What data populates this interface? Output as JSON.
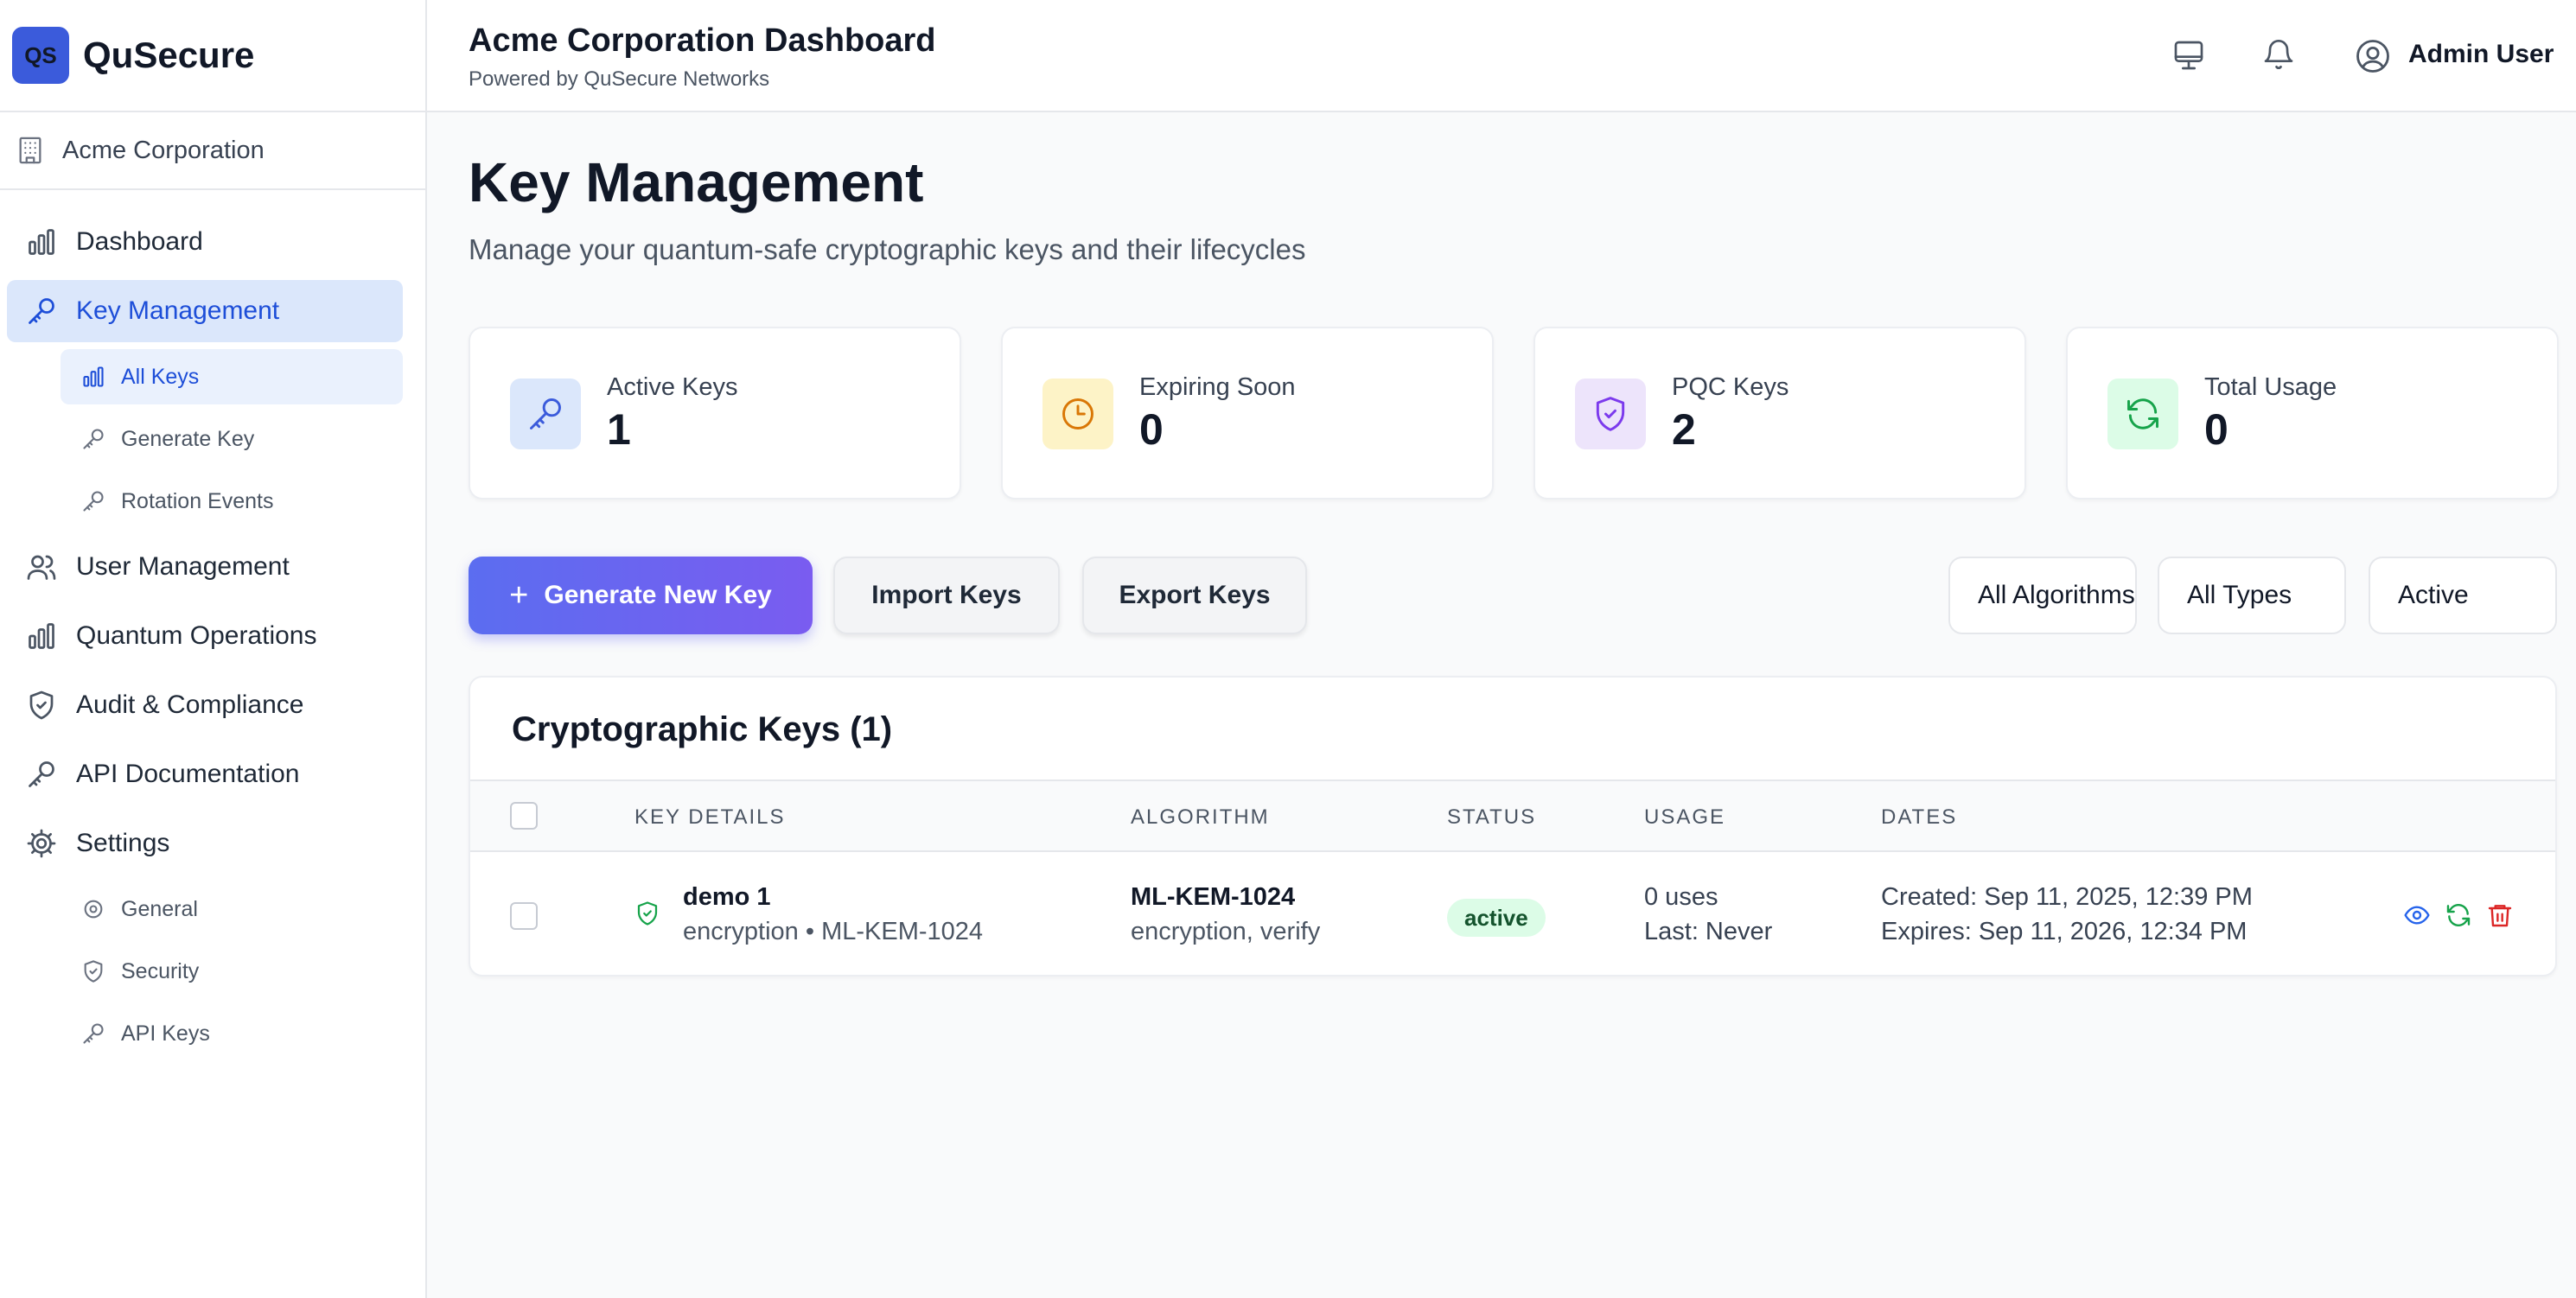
{
  "brand": {
    "logo_text": "QS",
    "name": "QuSecure"
  },
  "org": {
    "name": "Acme Corporation"
  },
  "sidebar": {
    "items": [
      {
        "label": "Dashboard",
        "icon": "bar-chart-icon"
      },
      {
        "label": "Key Management",
        "icon": "key-icon",
        "active": true,
        "subitems": [
          {
            "label": "All Keys",
            "icon": "bar-chart-icon",
            "active": true
          },
          {
            "label": "Generate Key",
            "icon": "key-icon"
          },
          {
            "label": "Rotation Events",
            "icon": "key-icon"
          }
        ]
      },
      {
        "label": "User Management",
        "icon": "users-icon"
      },
      {
        "label": "Quantum Operations",
        "icon": "bar-chart-icon"
      },
      {
        "label": "Audit & Compliance",
        "icon": "shield-icon"
      },
      {
        "label": "API Documentation",
        "icon": "key-icon"
      },
      {
        "label": "Settings",
        "icon": "gear-icon",
        "subitems": [
          {
            "label": "General",
            "icon": "gear-icon"
          },
          {
            "label": "Security",
            "icon": "shield-icon"
          },
          {
            "label": "API Keys",
            "icon": "key-icon"
          }
        ]
      }
    ]
  },
  "header": {
    "title": "Acme Corporation Dashboard",
    "subtitle": "Powered by QuSecure Networks",
    "user_name": "Admin User"
  },
  "page": {
    "title": "Key Management",
    "subtitle": "Manage your quantum-safe cryptographic keys and their lifecycles"
  },
  "stats": [
    {
      "label": "Active Keys",
      "value": "1",
      "icon": "key-icon",
      "bg": "#dbe7fb",
      "color": "#3b5bdb"
    },
    {
      "label": "Expiring Soon",
      "value": "0",
      "icon": "clock-icon",
      "bg": "#fdf3c7",
      "color": "#d97706"
    },
    {
      "label": "PQC Keys",
      "value": "2",
      "icon": "shield-check-icon",
      "bg": "#ede4fb",
      "color": "#7c3aed"
    },
    {
      "label": "Total Usage",
      "value": "0",
      "icon": "refresh-icon",
      "bg": "#dcfce7",
      "color": "#16a34a"
    }
  ],
  "actions": {
    "generate": "Generate New Key",
    "import": "Import Keys",
    "export": "Export Keys"
  },
  "filters": {
    "algorithm": "All Algorithms",
    "type": "All Types",
    "status": "Active"
  },
  "table": {
    "title": "Cryptographic Keys (1)",
    "columns": [
      "KEY DETAILS",
      "ALGORITHM",
      "STATUS",
      "USAGE",
      "DATES"
    ],
    "rows": [
      {
        "name": "demo 1",
        "details": "encryption • ML-KEM-1024",
        "algorithm": "ML-KEM-1024",
        "operations": "encryption, verify",
        "status": "active",
        "uses": "0 uses",
        "last": "Last: Never",
        "created": "Created: Sep 11, 2025, 12:39 PM",
        "expires": "Expires: Sep 11, 2026, 12:34 PM"
      }
    ]
  }
}
